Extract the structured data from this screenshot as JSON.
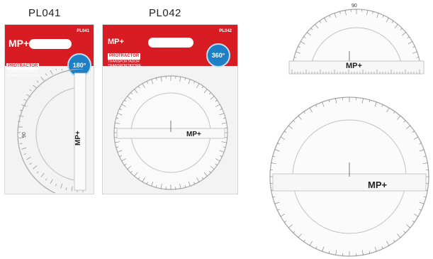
{
  "product_codes": {
    "left": "PL041",
    "middle": "PL042"
  },
  "pack_left": {
    "code": "PL041",
    "brand": "MP+",
    "title": "PROTRACTOR",
    "subtitle_1": "TRANSPORTADOR",
    "subtitle_2": "TRANSPORTATORE",
    "badge": "180°",
    "ruler_brand": "MP+",
    "dial_label": "90"
  },
  "pack_middle": {
    "code": "PL042",
    "brand": "MP+",
    "title": "PROTRACTOR",
    "subtitle_1": "TRANSPORTADOR",
    "subtitle_2": "TRANSPORTATORE",
    "badge": "360°",
    "ruler_brand": "MP+"
  },
  "loose_half": {
    "brand": "MP+",
    "top_label": "90"
  },
  "loose_full": {
    "brand": "MP+"
  },
  "colors": {
    "brand_red": "#d81c24",
    "badge_blue": "#1f7fc6"
  }
}
